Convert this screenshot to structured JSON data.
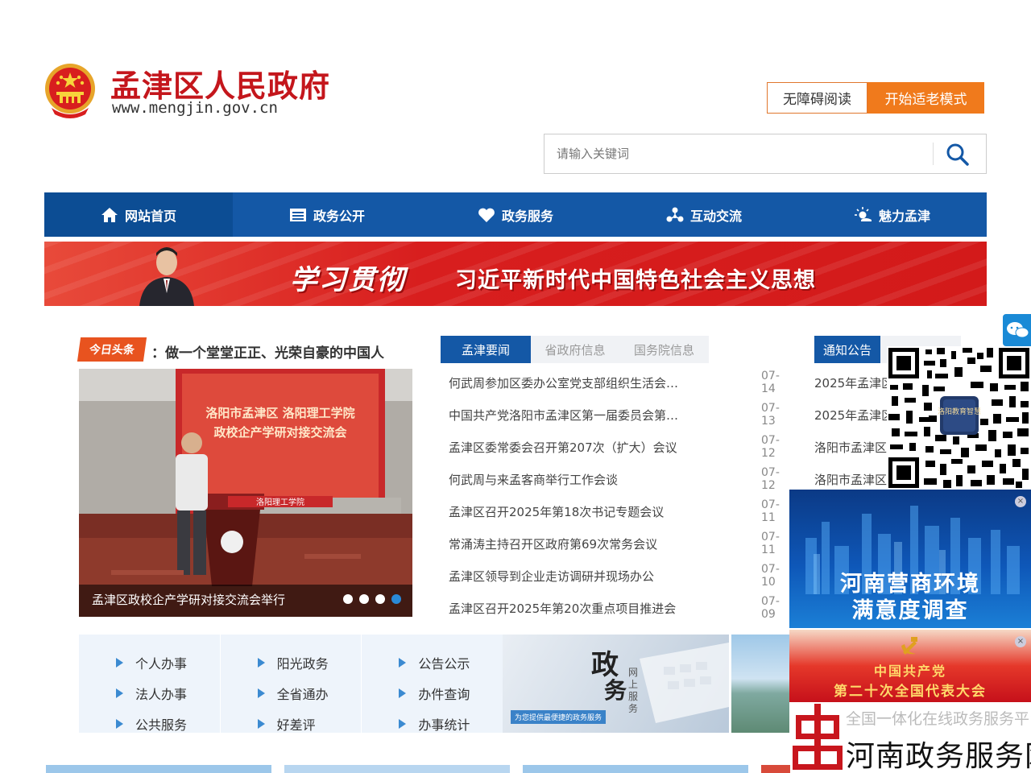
{
  "header": {
    "site_title": "孟津区人民政府",
    "site_url": "www.mengjin.gov.cn",
    "accessibility_button": "无障碍阅读",
    "elder_mode_button": "开始适老模式",
    "search_placeholder": "请输入关键词"
  },
  "nav": {
    "items": [
      {
        "label": "网站首页",
        "icon": "home-icon"
      },
      {
        "label": "政务公开",
        "icon": "document-icon"
      },
      {
        "label": "政务服务",
        "icon": "heart-icon"
      },
      {
        "label": "互动交流",
        "icon": "network-icon"
      },
      {
        "label": "魅力孟津",
        "icon": "sun-icon"
      }
    ]
  },
  "banner": {
    "slogan_part1": "学习贯彻",
    "slogan_part2": "习近平新时代中国特色社会主义思想"
  },
  "headline": {
    "badge": "今日头条",
    "text": "：做一个堂堂正正、光荣自豪的中国人"
  },
  "slider": {
    "caption": "孟津区政校企产学研对接交流会举行",
    "screen_title1": "洛阳市孟津区 洛阳理工学院",
    "screen_title2": "政校企产学研对接交流会",
    "podium_label": "洛阳理工学院"
  },
  "news": {
    "tabs": [
      "孟津要闻",
      "省政府信息",
      "国务院信息"
    ],
    "items": [
      {
        "title": "何武周参加区委办公室党支部组织生活会…",
        "date": "07-14"
      },
      {
        "title": "中国共产党洛阳市孟津区第一届委员会第…",
        "date": "07-13"
      },
      {
        "title": "孟津区委常委会召开第207次（扩大）会议",
        "date": "07-12"
      },
      {
        "title": "何武周与来孟客商举行工作会谈",
        "date": "07-12"
      },
      {
        "title": "孟津区召开2025年第18次书记专题会议",
        "date": "07-11"
      },
      {
        "title": "常涌涛主持召开区政府第69次常务会议",
        "date": "07-11"
      },
      {
        "title": "孟津区领导到企业走访调研并现场办公",
        "date": "07-10"
      },
      {
        "title": "孟津区召开2025年第20次重点项目推进会",
        "date": "07-09"
      }
    ]
  },
  "notices": {
    "tab": "通知公告",
    "items": [
      "2025年孟津区",
      "2025年孟津区",
      "洛阳市孟津区",
      "洛阳市孟津区"
    ]
  },
  "qr": {
    "center_label": "洛阳教育智慧"
  },
  "float_ads": {
    "business_line1": "河南营商环境",
    "business_line2": "满意度调查",
    "party_line1": "中国共产党",
    "party_line2": "第二十次全国代表大会",
    "close_symbol": "×"
  },
  "services": {
    "columns": [
      [
        "个人办事",
        "法人办事",
        "公共服务"
      ],
      [
        "阳光政务",
        "全省通办",
        "好差评"
      ],
      [
        "公告公示",
        "办件查询",
        "办事统计"
      ]
    ]
  },
  "gov_card": {
    "big1": "政",
    "big2": "务",
    "small": "网上服务",
    "tag": "为您提供最便捷的政务服务"
  },
  "henan_platform": {
    "faint_text": "全国一体化在线政务服务平台",
    "name": "河南政务服务网"
  },
  "colors": {
    "brand_blue": "#1458a6",
    "brand_red": "#c4161c",
    "accent_orange": "#f07a1c"
  }
}
